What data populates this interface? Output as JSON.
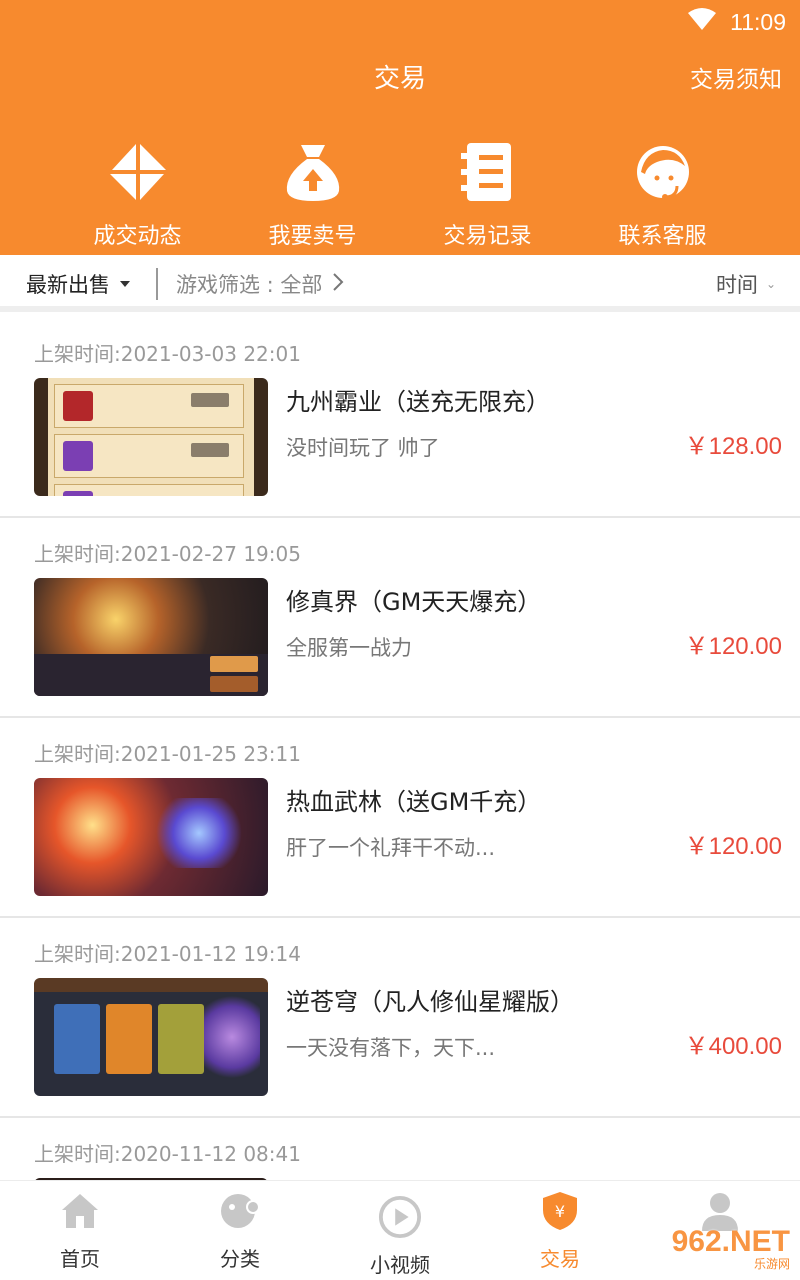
{
  "status_bar": {
    "time": "11:09"
  },
  "header": {
    "title": "交易",
    "notice": "交易须知"
  },
  "quick_actions": [
    {
      "label": "成交动态",
      "icon": "pinwheel-icon"
    },
    {
      "label": "我要卖号",
      "icon": "money-bag-icon"
    },
    {
      "label": "交易记录",
      "icon": "record-book-icon"
    },
    {
      "label": "联系客服",
      "icon": "customer-service-icon"
    }
  ],
  "filter": {
    "sort": "最新出售",
    "game": "游戏筛选 : 全部",
    "time": "时间"
  },
  "listings": [
    {
      "date": "上架时间:2021-03-03 22:01",
      "name": "九州霸业（送充无限充）",
      "desc": "没时间玩了  帅了",
      "price": "￥128.00"
    },
    {
      "date": "上架时间:2021-02-27 19:05",
      "name": "修真界（GM天天爆充）",
      "desc": "全服第一战力",
      "price": "￥120.00"
    },
    {
      "date": "上架时间:2021-01-25 23:11",
      "name": "热血武林（送GM千充）",
      "desc": "肝了一个礼拜干不动...",
      "price": "￥120.00"
    },
    {
      "date": "上架时间:2021-01-12 19:14",
      "name": "逆苍穹（凡人修仙星耀版）",
      "desc": "一天没有落下，天下...",
      "price": "￥400.00"
    },
    {
      "date": "上架时间:2020-11-12 08:41",
      "name": "",
      "desc": "",
      "price": ""
    }
  ],
  "bottom_nav": [
    {
      "label": "首页",
      "icon": "home-icon"
    },
    {
      "label": "分类",
      "icon": "category-icon"
    },
    {
      "label": "小视频",
      "icon": "video-play-icon"
    },
    {
      "label": "交易",
      "icon": "trade-shield-icon",
      "active": true
    },
    {
      "label": "",
      "icon": "profile-icon"
    }
  ],
  "watermark": {
    "main": "962.NET",
    "sub": "乐游网"
  },
  "colors": {
    "brand": "#f78a2e",
    "price": "#e84b3c"
  }
}
